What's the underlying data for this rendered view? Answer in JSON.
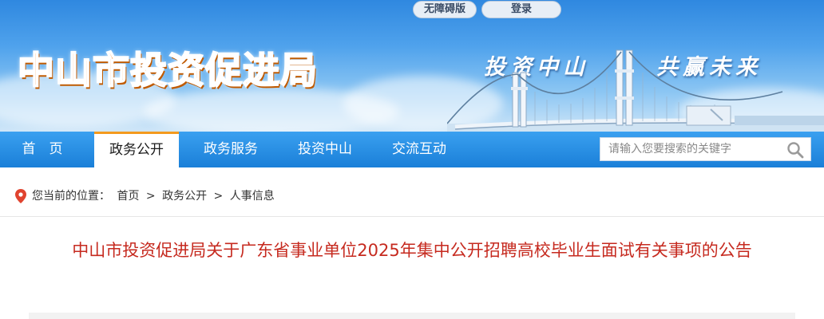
{
  "top_links": {
    "accessible": "无障碍版",
    "login": "登录"
  },
  "site_title": "中山市投资促进局",
  "slogan": {
    "left": "投资中山",
    "right": "共赢未来"
  },
  "nav": {
    "items": [
      {
        "label": "首　页"
      },
      {
        "label": "政务公开",
        "active": true
      },
      {
        "label": "政务服务"
      },
      {
        "label": "投资中山"
      },
      {
        "label": "交流互动"
      }
    ]
  },
  "search": {
    "placeholder": "请输入您要搜索的关键字",
    "icon": "search-icon"
  },
  "breadcrumb": {
    "prefix": "您当前的位置：",
    "items": [
      "首页",
      "政务公开",
      "人事信息"
    ],
    "separator": ">"
  },
  "article": {
    "title": "中山市投资促进局关于广东省事业单位2025年集中公开招聘高校毕业生面试有关事项的公告"
  },
  "colors": {
    "nav_blue": "#1a7fd8",
    "active_accent": "#f39a1e",
    "title_red": "#c62a1f",
    "site_title_orange": "#ff8a1f"
  }
}
